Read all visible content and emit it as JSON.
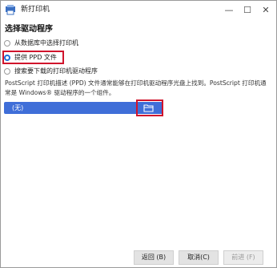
{
  "window": {
    "title": "新打印机",
    "minimize_glyph": "—",
    "maximize_glyph": "☐",
    "close_glyph": "✕"
  },
  "page": {
    "heading": "选择驱动程序"
  },
  "options": [
    {
      "label": "从数据库中选择打印机",
      "selected": false
    },
    {
      "label": "提供 PPD 文件",
      "selected": true
    },
    {
      "label": "搜索要下载的打印机驱动程序",
      "selected": false
    }
  ],
  "description": {
    "line1": "PostScript 打印机描述 (PPD) 文件通常能够在打印机驱动程序光盘上找到。PostScript 打印机通",
    "line2": "常是 Windows® 驱动程序的一个组件。"
  },
  "file_chooser": {
    "value": "(无)",
    "icon": "folder-open-icon"
  },
  "buttons": {
    "back": "返回 (B)",
    "cancel": "取消(C)",
    "forward": "前进 (F)"
  },
  "colors": {
    "accent": "#1e6fd9",
    "file_bar": "#3f6ed8",
    "highlight": "#d0142c"
  }
}
